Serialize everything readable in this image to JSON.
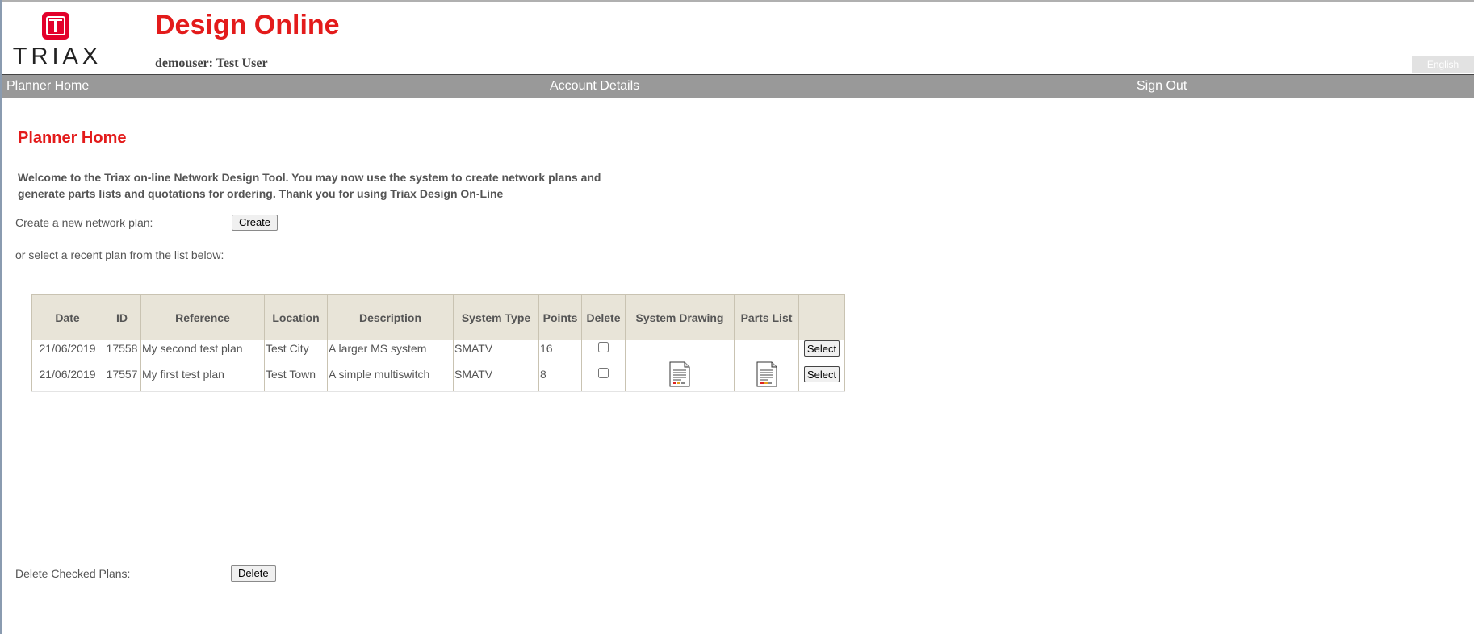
{
  "header": {
    "logo_text": "TRIAX",
    "app_title": "Design Online",
    "user_info": "demouser: Test User",
    "language": "English"
  },
  "nav": {
    "home": "Planner Home",
    "account": "Account Details",
    "signout": "Sign Out"
  },
  "main": {
    "title": "Planner Home",
    "welcome": "Welcome to the Triax on-line Network Design Tool. You may now use the system to create network plans and generate parts lists and quotations for ordering. Thank you for using Triax Design On-Line",
    "create_label": "Create a new network plan:",
    "create_button": "Create",
    "select_label": "or select a recent plan from the list below:",
    "delete_label": "Delete Checked Plans:",
    "delete_button": "Delete"
  },
  "table": {
    "headers": [
      "Date",
      "ID",
      "Reference",
      "Location",
      "Description",
      "System Type",
      "Points",
      "Delete",
      "System Drawing",
      "Parts List",
      ""
    ],
    "rows": [
      {
        "date": "21/06/2019",
        "id": "17558",
        "reference": "My second test plan",
        "location": "Test City",
        "description": "A larger MS system",
        "system_type": "SMATV",
        "points": "16",
        "delete_checked": false,
        "has_drawing": false,
        "has_parts": false,
        "select_label": "Select"
      },
      {
        "date": "21/06/2019",
        "id": "17557",
        "reference": "My first test plan",
        "location": "Test Town",
        "description": "A simple multiswitch",
        "system_type": "SMATV",
        "points": "8",
        "delete_checked": false,
        "has_drawing": true,
        "has_parts": true,
        "select_label": "Select"
      }
    ]
  },
  "colors": {
    "brand_red": "#e31b1b",
    "nav_bg": "#999999",
    "table_header_bg": "#e8e4d8"
  },
  "icons": {
    "document": "document-icon"
  }
}
